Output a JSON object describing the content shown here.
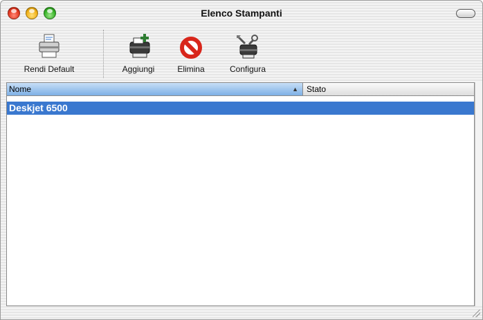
{
  "window": {
    "title": "Elenco Stampanti"
  },
  "toolbar": {
    "items": [
      {
        "label": "Rendi Default",
        "icon": "printer-icon"
      },
      {
        "label": "Aggiungi",
        "icon": "add-printer-icon"
      },
      {
        "label": "Elimina",
        "icon": "delete-icon"
      },
      {
        "label": "Configura",
        "icon": "configure-printer-icon"
      }
    ]
  },
  "table": {
    "columns": [
      "Nome",
      "Stato"
    ],
    "sort_column": "Nome",
    "sort_direction": "ascending",
    "rows": [
      {
        "name": "Deskjet 6500",
        "status": "",
        "selected": true
      }
    ]
  },
  "colors": {
    "selection": "#3a78cf",
    "sorted_header": "#9cc4ee",
    "traffic_red": "#e53a22",
    "traffic_yellow": "#f2b21a",
    "traffic_green": "#39b52a",
    "delete_red": "#d8261b"
  }
}
